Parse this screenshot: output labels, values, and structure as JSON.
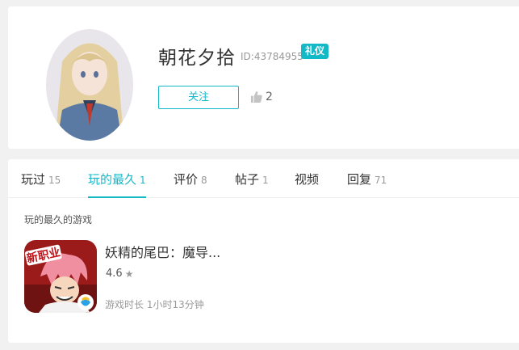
{
  "profile": {
    "username": "朝花夕拾",
    "user_id": "ID:43784955",
    "badge": "礼仪",
    "follow_label": "关注",
    "likes": "2"
  },
  "tabs": [
    {
      "label": "玩过",
      "count": "15",
      "active": false
    },
    {
      "label": "玩的最久",
      "count": "1",
      "active": true
    },
    {
      "label": "评价",
      "count": "8",
      "active": false
    },
    {
      "label": "帖子",
      "count": "1",
      "active": false
    },
    {
      "label": "视频",
      "count": "",
      "active": false
    },
    {
      "label": "回复",
      "count": "71",
      "active": false
    }
  ],
  "section": {
    "title": "玩的最久的游戏"
  },
  "game": {
    "title": "妖精的尾巴：魔导...",
    "rating": "4.6",
    "play_time": "游戏时长 1小时13分钟",
    "icon_label": "新职业"
  },
  "colors": {
    "accent": "#14b9c8",
    "page_bg": "#f1f1f1"
  }
}
